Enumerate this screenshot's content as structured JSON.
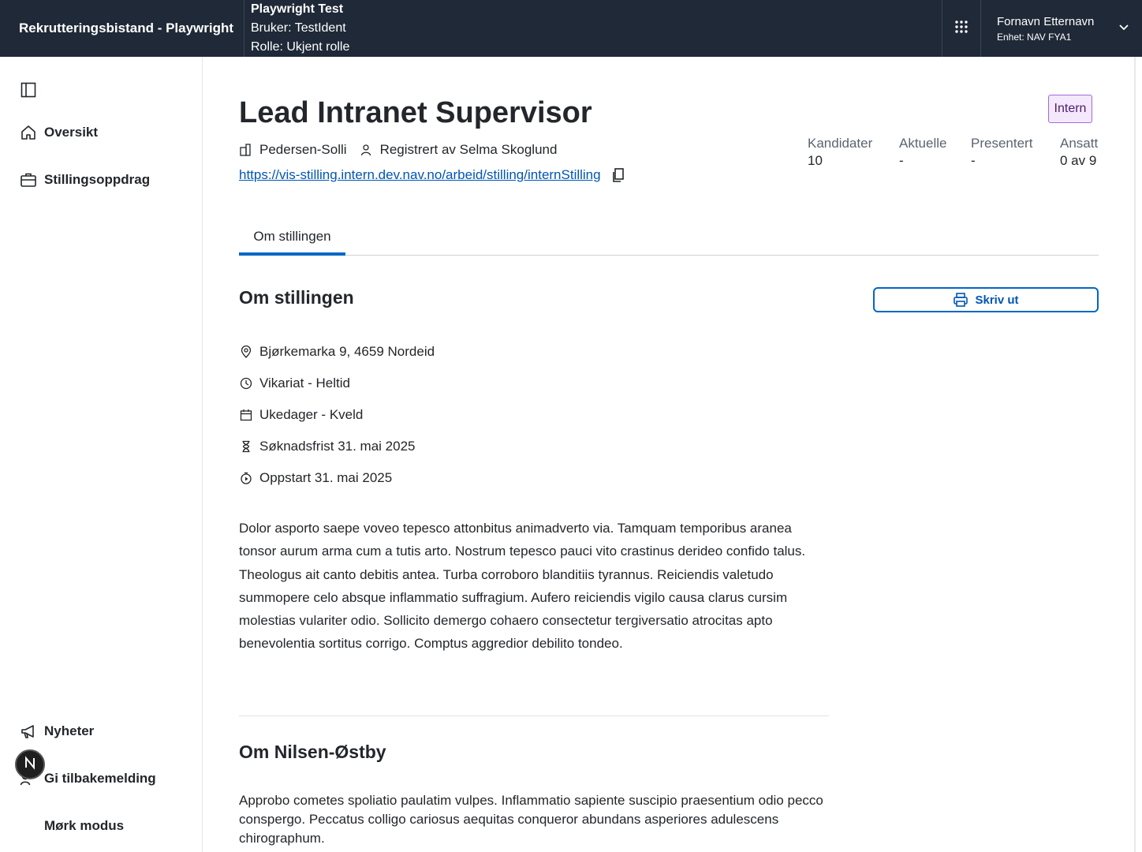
{
  "header": {
    "app_title": "Rekrutteringsbistand - Playwright",
    "env_title": "Playwright Test",
    "env_user": "Bruker: TestIdent",
    "env_role": "Rolle: Ukjent rolle",
    "user_name": "Fornavn Etternavn",
    "user_unit": "Enhet: NAV FYA1"
  },
  "sidebar": {
    "items": [
      {
        "label": "Oversikt",
        "icon": "house-icon"
      },
      {
        "label": "Stillingsoppdrag",
        "icon": "briefcase-icon"
      }
    ],
    "bottom_items": [
      {
        "label": "Nyheter",
        "icon": "megaphone-icon"
      },
      {
        "label": "Gi tilbakemelding",
        "icon": "feedback-icon"
      },
      {
        "label": "Mørk modus",
        "icon": "moon-icon"
      }
    ]
  },
  "job": {
    "title": "Lead Intranet Supervisor",
    "badge": "Intern",
    "employer": "Pedersen-Solli",
    "registered_by": "Registrert av Selma Skoglund",
    "url": "https://vis-stilling.intern.dev.nav.no/arbeid/stilling/internStilling"
  },
  "stats": [
    {
      "label": "Kandidater",
      "value": "10"
    },
    {
      "label": "Aktuelle",
      "value": "-"
    },
    {
      "label": "Presentert",
      "value": "-"
    },
    {
      "label": "Ansatt",
      "value": "0 av 9"
    }
  ],
  "tabs": [
    {
      "label": "Om stillingen"
    }
  ],
  "about": {
    "heading": "Om stillingen",
    "print_label": "Skriv ut",
    "facts": [
      {
        "icon": "location-pin-icon",
        "text": "Bjørkemarka 9, 4659 Nordeid"
      },
      {
        "icon": "clock-icon",
        "text": "Vikariat - Heltid"
      },
      {
        "icon": "calendar-icon",
        "text": "Ukedager - Kveld"
      },
      {
        "icon": "hourglass-icon",
        "text": "Søknadsfrist 31. mai 2025"
      },
      {
        "icon": "stopwatch-icon",
        "text": "Oppstart 31. mai 2025"
      }
    ],
    "description": "Dolor asporto saepe voveo tepesco attonbitus animadverto via. Tamquam temporibus aranea tonsor aurum arma cum a tutis arto. Nostrum tepesco pauci vito crastinus derideo confido talus. Theologus ait canto debitis antea. Turba corroboro blanditiis tyrannus. Reiciendis valetudo summopere celo absque inflammatio suffragium. Aufero reiciendis vigilo causa clarus cursim molestias vulariter odio. Sollicito demergo cohaero consectetur tergiversatio atrocitas apto benevolentia sortitus corrigo. Comptus aggredior debilito tondeo."
  },
  "employer_section": {
    "heading": "Om Nilsen-Østby",
    "description": "Approbo cometes spoliatio paulatim vulpes. Inflammatio sapiente suscipio praesentium odio pecco conspergo. Peccatus colligo cariosus aequitas conqueror abundans asperiores adulescens chirographum."
  }
}
